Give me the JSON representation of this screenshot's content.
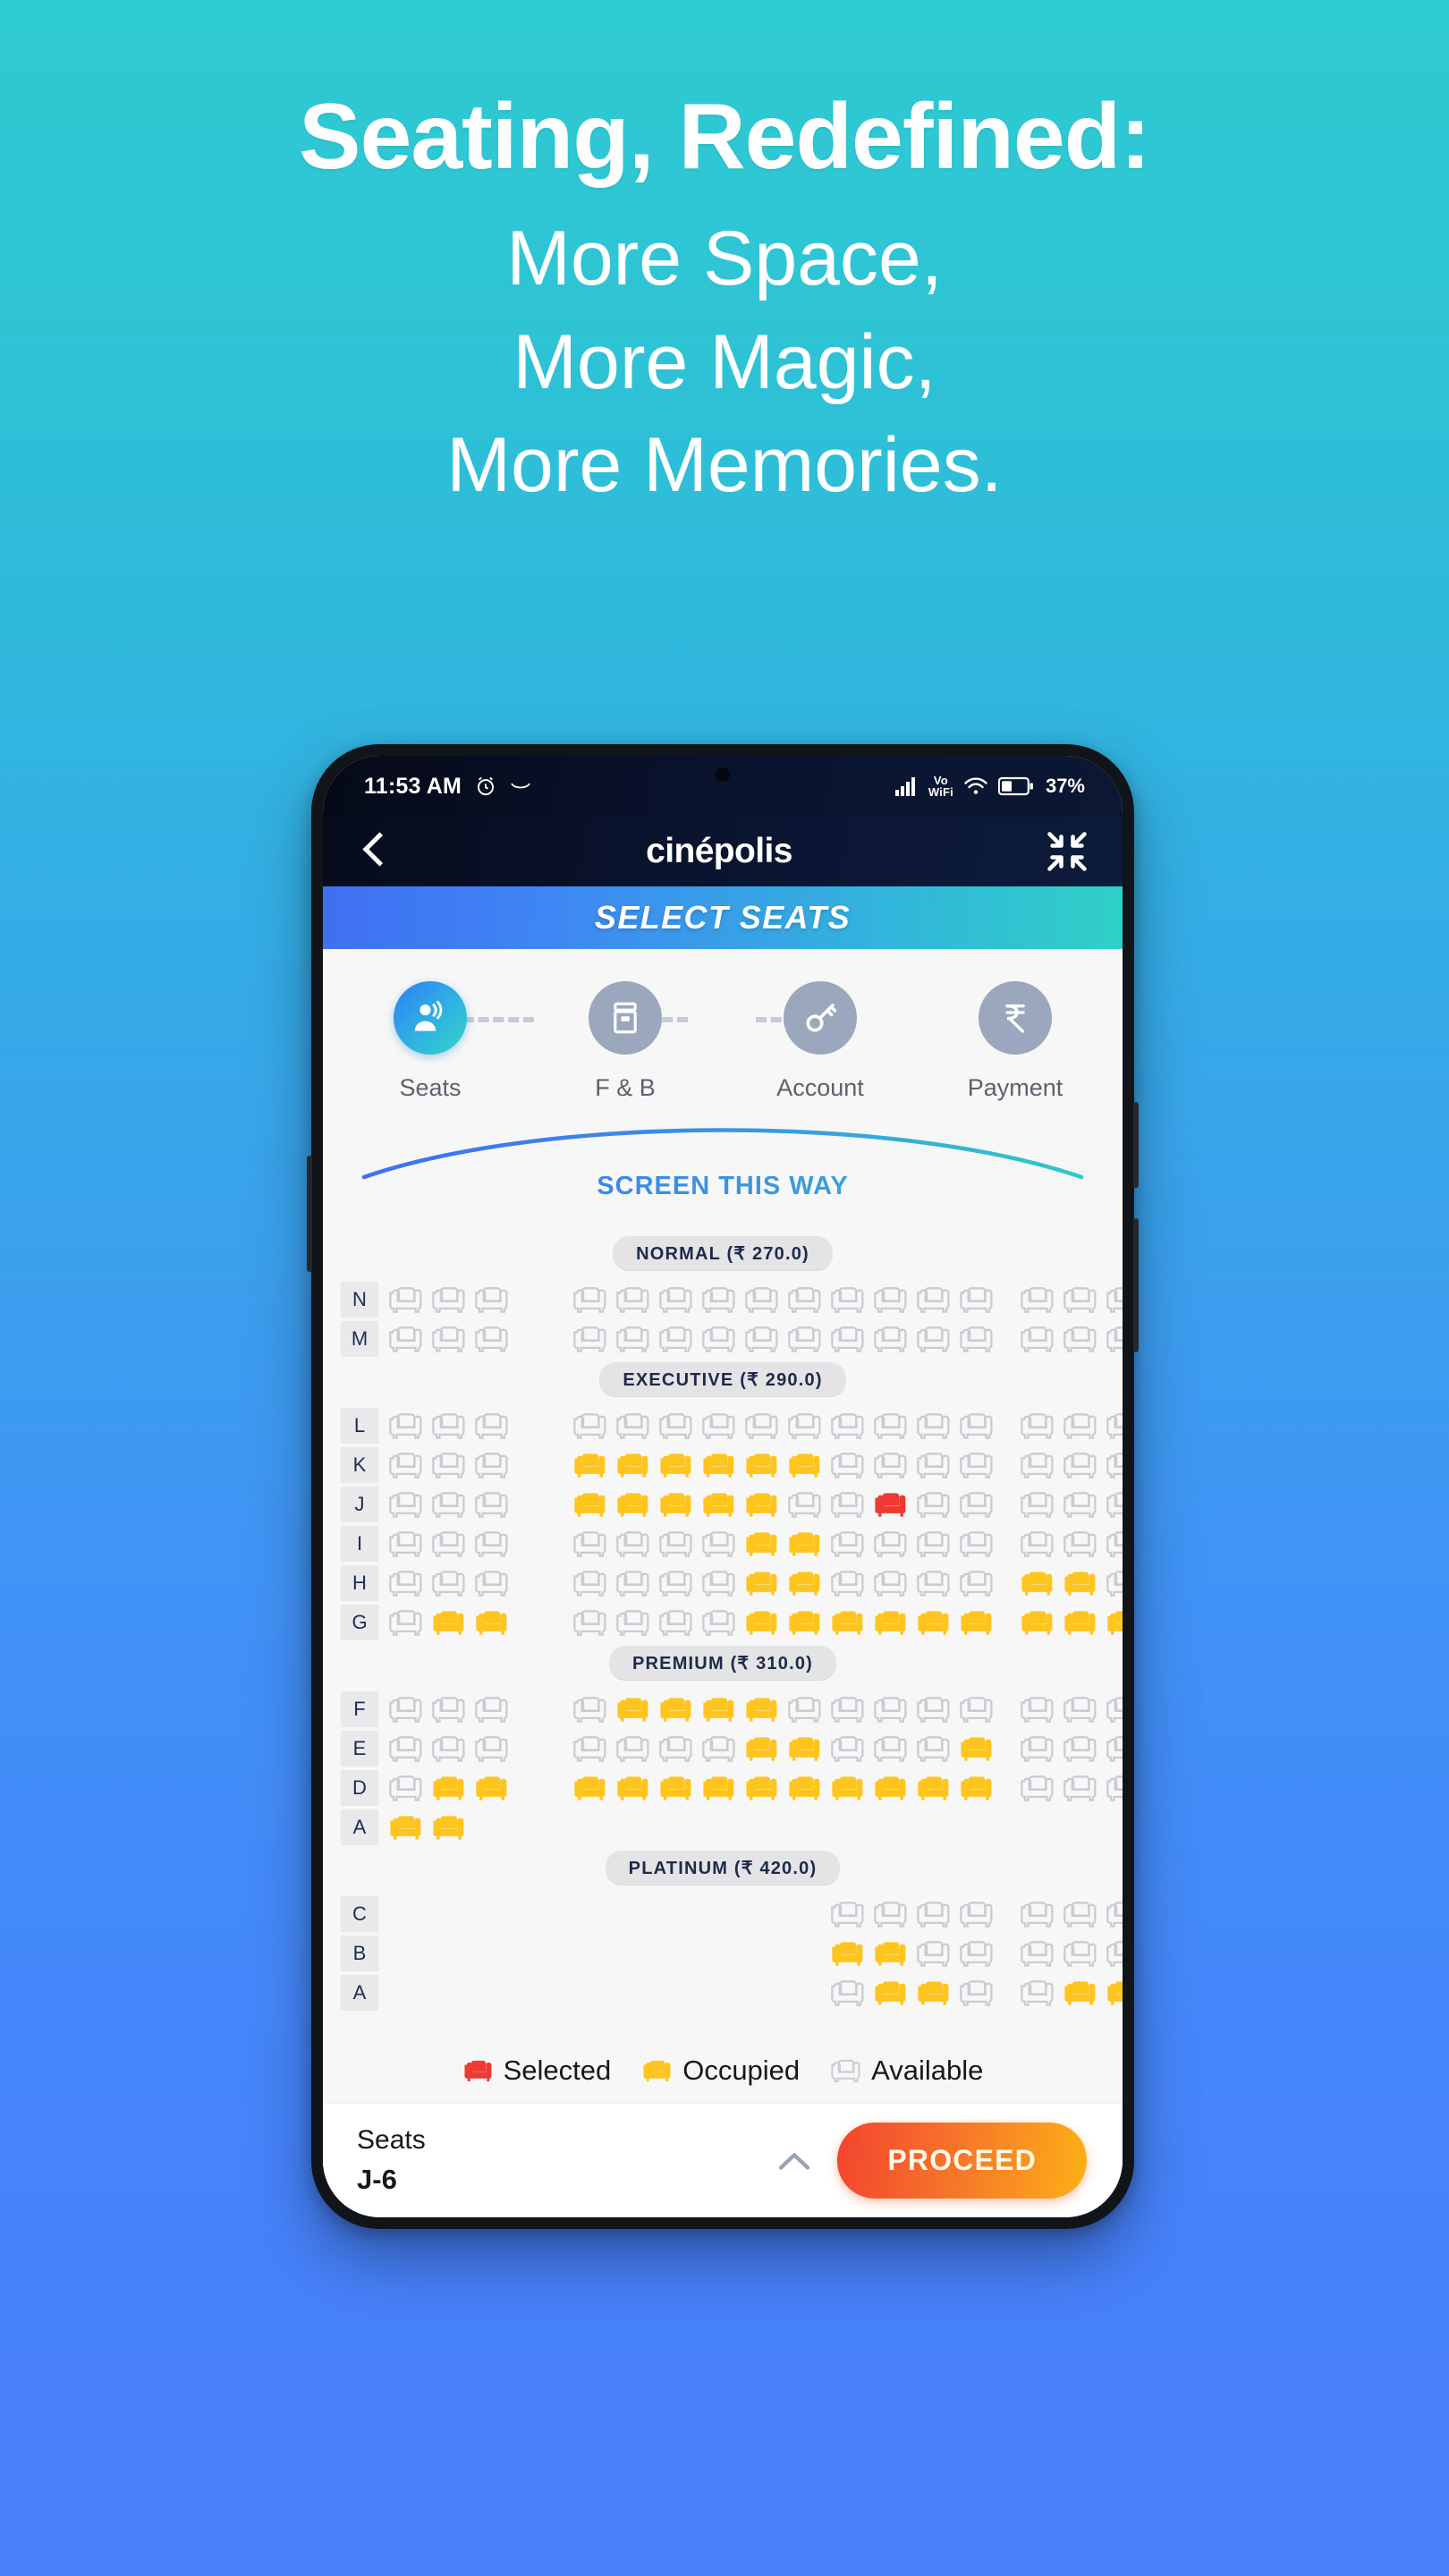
{
  "promo": {
    "headline": "Seating, Redefined:",
    "lines": [
      "More Space,",
      "More Magic,",
      "More Memories."
    ]
  },
  "phone": {
    "statusbar": {
      "time": "11:53 AM",
      "alarm_icon": "alarm-icon",
      "sleep_icon": "crescent-icon",
      "signal_icon": "cellular-signal-icon",
      "vowifi_top": "Vo",
      "vowifi_bottom": "WiFi",
      "wifi_icon": "wifi-icon",
      "battery_icon": "battery-icon",
      "battery_percent": "37%"
    },
    "appbar": {
      "back_icon": "back-chevron-icon",
      "brand": "cinépolis",
      "collapse_icon": "collapse-arrows-icon"
    },
    "title_band": "SELECT SEATS",
    "stepper": [
      {
        "label": "Seats",
        "icon": "people-icon",
        "active": true
      },
      {
        "label": "F & B",
        "icon": "popcorn-icon",
        "active": false
      },
      {
        "label": "Account",
        "icon": "key-icon",
        "active": false
      },
      {
        "label": "Payment",
        "icon": "rupee-icon",
        "active": false
      }
    ],
    "screen_label": "SCREEN THIS WAY",
    "legend": [
      {
        "label": "Selected",
        "state": "selected"
      },
      {
        "label": "Occupied",
        "state": "occupied"
      },
      {
        "label": "Available",
        "state": "available"
      }
    ],
    "footer": {
      "seats_label": "Seats",
      "seats_value": "J-6",
      "expand_icon": "chevron-up-icon",
      "proceed_label": "PROCEED"
    },
    "colors": {
      "selected": "#ee3a33",
      "occupied": "#ffc51f",
      "available": "#c9ccd2",
      "accent_blue": "#3f6ff2",
      "accent_teal": "#2fd0c7",
      "proceed_from": "#f3442f",
      "proceed_to": "#fcb017"
    },
    "seatmap": {
      "sections": [
        {
          "category": "NORMAL",
          "price": "270.0",
          "chip": "NORMAL (₹ 270.0)",
          "rows": [
            {
              "label": "N",
              "left": [
                "a",
                "a",
                "a"
              ],
              "center": [
                "a",
                "a",
                "a",
                "a",
                "a",
                "a",
                "a",
                "a",
                "a",
                "a"
              ],
              "right": [
                "a",
                "a",
                "a"
              ]
            },
            {
              "label": "M",
              "left": [
                "a",
                "a",
                "a"
              ],
              "center": [
                "a",
                "a",
                "a",
                "a",
                "a",
                "a",
                "a",
                "a",
                "a",
                "a"
              ],
              "right": [
                "a",
                "a",
                "a"
              ]
            }
          ]
        },
        {
          "category": "EXECUTIVE",
          "price": "290.0",
          "chip": "EXECUTIVE (₹ 290.0)",
          "rows": [
            {
              "label": "L",
              "left": [
                "a",
                "a",
                "a"
              ],
              "center": [
                "a",
                "a",
                "a",
                "a",
                "a",
                "a",
                "a",
                "a",
                "a",
                "a"
              ],
              "right": [
                "a",
                "a",
                "a"
              ]
            },
            {
              "label": "K",
              "left": [
                "a",
                "a",
                "a"
              ],
              "center": [
                "o",
                "o",
                "o",
                "o",
                "o",
                "o",
                "a",
                "a",
                "a",
                "a"
              ],
              "right": [
                "a",
                "a",
                "a"
              ]
            },
            {
              "label": "J",
              "left": [
                "a",
                "a",
                "a"
              ],
              "center": [
                "o",
                "o",
                "o",
                "o",
                "o",
                "a",
                "a",
                "s",
                "a",
                "a"
              ],
              "right": [
                "a",
                "a",
                "a"
              ]
            },
            {
              "label": "I",
              "left": [
                "a",
                "a",
                "a"
              ],
              "center": [
                "a",
                "a",
                "a",
                "a",
                "o",
                "o",
                "a",
                "a",
                "a",
                "a"
              ],
              "right": [
                "a",
                "a",
                "a"
              ]
            },
            {
              "label": "H",
              "left": [
                "a",
                "a",
                "a"
              ],
              "center": [
                "a",
                "a",
                "a",
                "a",
                "o",
                "o",
                "a",
                "a",
                "a",
                "a"
              ],
              "right": [
                "o",
                "o",
                "a"
              ]
            },
            {
              "label": "G",
              "left": [
                "a",
                "o",
                "o"
              ],
              "center": [
                "a",
                "a",
                "a",
                "a",
                "o",
                "o",
                "o",
                "o",
                "o",
                "o"
              ],
              "right": [
                "o",
                "o",
                "o"
              ]
            }
          ]
        },
        {
          "category": "PREMIUM",
          "price": "310.0",
          "chip": "PREMIUM (₹ 310.0)",
          "rows": [
            {
              "label": "F",
              "left": [
                "a",
                "a",
                "a"
              ],
              "center": [
                "a",
                "o",
                "o",
                "o",
                "o",
                "a",
                "a",
                "a",
                "a",
                "a"
              ],
              "right": [
                "a",
                "a",
                "a"
              ]
            },
            {
              "label": "E",
              "left": [
                "a",
                "a",
                "a"
              ],
              "center": [
                "a",
                "a",
                "a",
                "a",
                "o",
                "o",
                "a",
                "a",
                "a",
                "o"
              ],
              "right": [
                "a",
                "a",
                "a"
              ]
            },
            {
              "label": "D",
              "left": [
                "a",
                "o",
                "o"
              ],
              "center": [
                "o",
                "o",
                "o",
                "o",
                "o",
                "o",
                "o",
                "o",
                "o",
                "o"
              ],
              "right": [
                "a",
                "a",
                "a"
              ]
            },
            {
              "label": "A",
              "left": [
                "o",
                "o"
              ],
              "center": [],
              "right": []
            }
          ]
        },
        {
          "category": "PLATINUM",
          "price": "420.0",
          "chip": "PLATINUM (₹ 420.0)",
          "rows": [
            {
              "label": "C",
              "left": [],
              "center": [
                "_",
                "_",
                "_",
                "_",
                "_",
                "_",
                "a",
                "a",
                "a",
                "a"
              ],
              "right": [
                "a",
                "a",
                "a"
              ]
            },
            {
              "label": "B",
              "left": [],
              "center": [
                "_",
                "_",
                "_",
                "_",
                "_",
                "_",
                "o",
                "o",
                "a",
                "a"
              ],
              "right": [
                "a",
                "a",
                "a"
              ]
            },
            {
              "label": "A",
              "left": [],
              "center": [
                "_",
                "_",
                "_",
                "_",
                "_",
                "_",
                "a",
                "o",
                "o",
                "a"
              ],
              "right": [
                "a",
                "o",
                "o"
              ]
            }
          ]
        }
      ]
    }
  }
}
